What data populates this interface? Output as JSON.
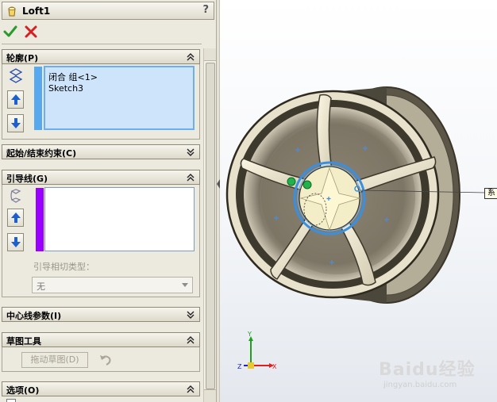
{
  "window": {
    "title": "Loft1",
    "help": "?"
  },
  "actions": {
    "ok": "ok",
    "cancel": "cancel"
  },
  "sections": {
    "profiles": {
      "title": "轮廓(P)",
      "items": [
        "闭合 组<1>",
        "Sketch3"
      ],
      "accent": "#58a8f0"
    },
    "start_end": {
      "title": "起始/结束约束(C)"
    },
    "guides": {
      "title": "引导线(G)",
      "items": [],
      "accent": "#9900ff",
      "tangency_label": "引导相切类型：",
      "tangency_value": "无"
    },
    "centerline": {
      "title": "中心线参数(I)"
    },
    "sketch_tools": {
      "title": "草图工具",
      "drag_sketch": "拖动草图(D)"
    },
    "options": {
      "title": "选项(O)"
    }
  },
  "viewport": {
    "callout": "系",
    "triad": {
      "x": "X",
      "y": "Y",
      "z": "Z"
    },
    "watermark": {
      "brand": "Baidu经验",
      "url": "jingyan.baidu.com"
    }
  },
  "colors": {
    "selection": "#3a8fe0",
    "endpoint": "#22b14c",
    "triad_x": "#e02020",
    "triad_y": "#20a020",
    "triad_z": "#2020d0"
  }
}
